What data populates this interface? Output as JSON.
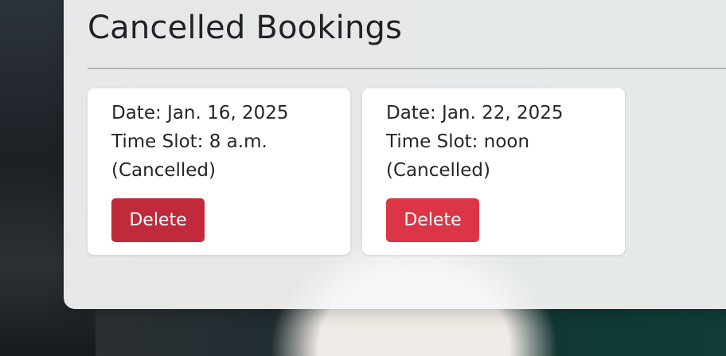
{
  "page": {
    "title": "Cancelled Bookings"
  },
  "bookings": [
    {
      "date": "Date: Jan. 16, 2025",
      "time_slot": "Time Slot: 8 a.m.",
      "status": "(Cancelled)",
      "delete_label": "Delete"
    },
    {
      "date": "Date: Jan. 22, 2025",
      "time_slot": "Time Slot: noon",
      "status": "(Cancelled)",
      "delete_label": "Delete"
    }
  ],
  "colors": {
    "delete_hover": "#c02a3a",
    "delete": "#dc3545",
    "panel": "#f5f6f6",
    "card": "#ffffff"
  }
}
